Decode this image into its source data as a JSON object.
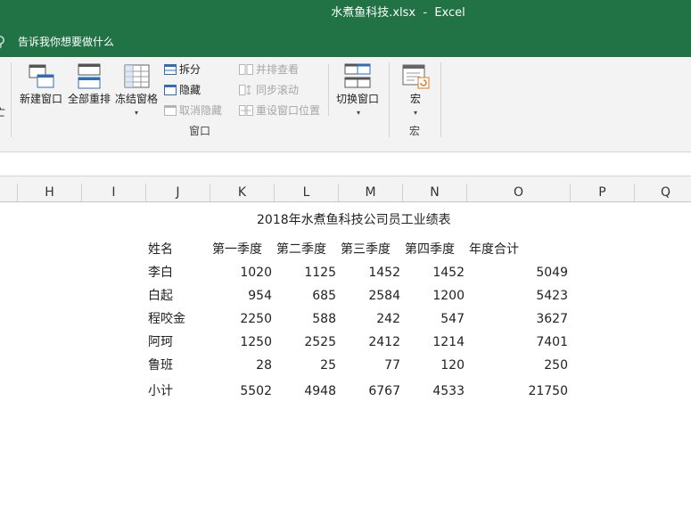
{
  "title_bar": {
    "title": "水煮鱼科技.xlsx  -  Excel",
    "bg": "#217346"
  },
  "tell_me": {
    "icon": "lightbulb-icon",
    "text": "告诉我你想要做什么"
  },
  "ribbon": {
    "partial_left_label": "亡",
    "window_group": {
      "new_window": "新建窗口",
      "arrange_all": "全部重排",
      "freeze_panes": "冻结窗格",
      "split": "拆分",
      "hide": "隐藏",
      "unhide": "取消隐藏",
      "view_side_by_side": "并排查看",
      "sync_scrolling": "同步滚动",
      "reset_window_position": "重设窗口位置",
      "switch_windows": "切换窗口",
      "label": "窗口"
    },
    "macros_group": {
      "macros": "宏",
      "label": "宏"
    }
  },
  "columns": [
    "H",
    "I",
    "J",
    "K",
    "L",
    "M",
    "N",
    "O",
    "P",
    "Q"
  ],
  "sheet": {
    "table_title": "2018年水煮鱼科技公司员工业绩表",
    "headers": [
      "姓名",
      "第一季度",
      "第二季度",
      "第三季度",
      "第四季度",
      "年度合计"
    ],
    "rows": [
      [
        "李白",
        "1020",
        "1125",
        "1452",
        "1452",
        "5049"
      ],
      [
        "白起",
        "954",
        "685",
        "2584",
        "1200",
        "5423"
      ],
      [
        "程咬金",
        "2250",
        "588",
        "242",
        "547",
        "3627"
      ],
      [
        "阿珂",
        "1250",
        "2525",
        "2412",
        "1214",
        "7401"
      ],
      [
        "鲁班",
        "28",
        "25",
        "77",
        "120",
        "250"
      ]
    ],
    "total": [
      "小计",
      "5502",
      "4948",
      "6767",
      "4533",
      "21750"
    ]
  }
}
